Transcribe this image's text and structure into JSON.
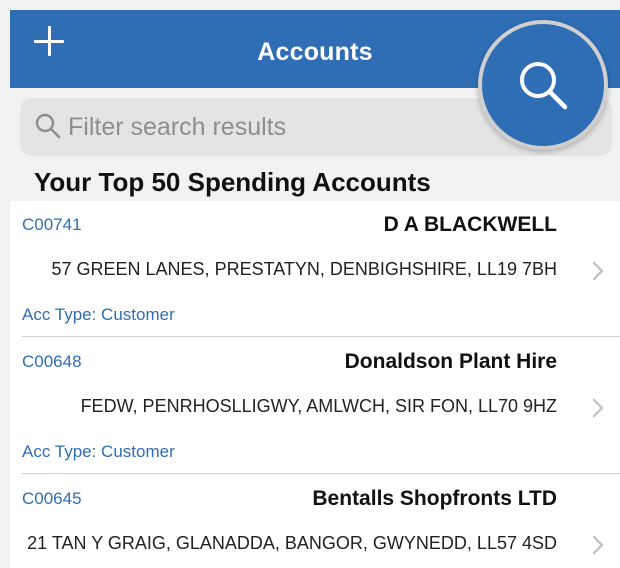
{
  "navbar": {
    "title": "Accounts",
    "add_icon": "plus-icon",
    "color": "#2f6db5"
  },
  "search": {
    "placeholder": "Filter search results",
    "icon": "search-icon",
    "fab_icon": "search-icon"
  },
  "section": {
    "title": "Your Top 50 Spending Accounts"
  },
  "accounts": [
    {
      "code": "C00741",
      "name": "D A BLACKWELL",
      "address": "57 GREEN LANES, PRESTATYN, DENBIGHSHIRE, LL19 7BH",
      "type": "Acc Type: Customer"
    },
    {
      "code": "C00648",
      "name": "Donaldson Plant Hire",
      "address": "FEDW, PENRHOSLLIGWY, AMLWCH, SIR FON, LL70 9HZ",
      "type": "Acc Type: Customer"
    },
    {
      "code": "C00645",
      "name": "Bentalls Shopfronts LTD",
      "address": "21 TAN Y GRAIG, GLANADDA, BANGOR, GWYNEDD, LL57 4SD",
      "type": ""
    }
  ],
  "colors": {
    "accent": "#2f6db5",
    "background": "#f2f2f2",
    "search_field": "#e4e4e4"
  }
}
